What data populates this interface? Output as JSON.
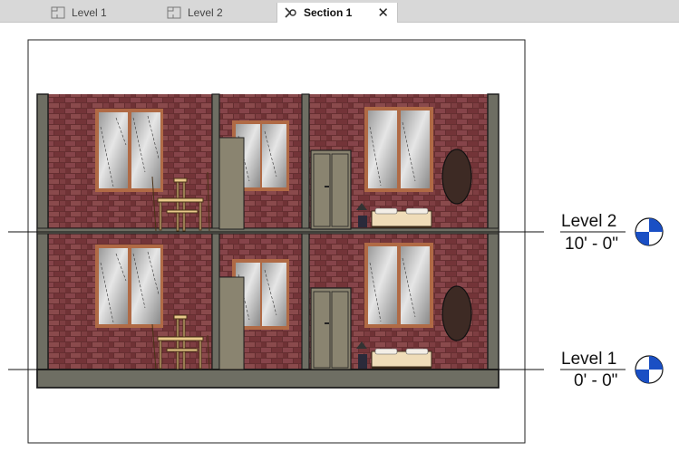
{
  "tabs": [
    {
      "label": "Level 1",
      "icon": "floor-plan-icon",
      "active": false
    },
    {
      "label": "Level 2",
      "icon": "floor-plan-icon",
      "active": false
    },
    {
      "label": "Section 1",
      "icon": "section-view-icon",
      "active": true
    }
  ],
  "close_icon": "close-icon",
  "levels": [
    {
      "name": "Level 2",
      "elevation": "10' - 0\""
    },
    {
      "name": "Level 1",
      "elevation": "0' - 0\""
    }
  ],
  "colors": {
    "brick": "#7a3a3c",
    "wall": "#6e6e63",
    "level_head": "#1a4fc4",
    "door": "#8a8470",
    "tab_bar": "#d8d8d8"
  }
}
